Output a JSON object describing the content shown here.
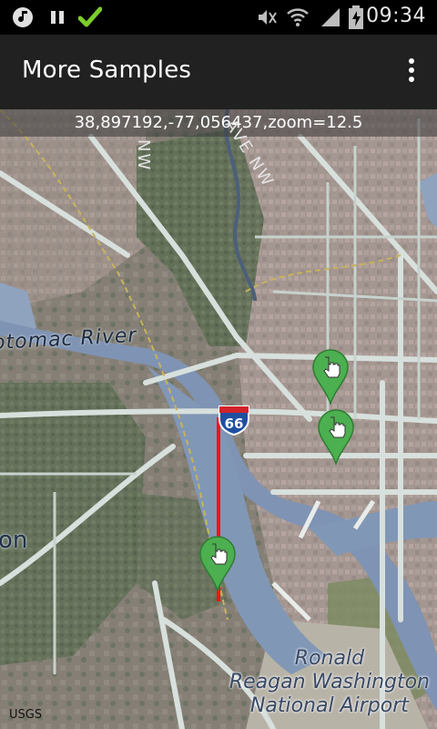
{
  "status_bar": {
    "time": "09:34",
    "icons": [
      "music-note-icon",
      "pause-icon",
      "checkmark-icon",
      "mute-icon",
      "wifi-icon",
      "signal-icon",
      "battery-icon"
    ]
  },
  "action_bar": {
    "title": "More Samples",
    "overflow_icon": "overflow-menu-icon"
  },
  "map": {
    "coordinates_text": "38,897192,-77,056437,zoom=12.5",
    "attribution": "USGS",
    "labels": {
      "river": "otomac River",
      "partial_place": "on",
      "airport_line1": "Ronald",
      "airport_line2": "Reagan Washington",
      "airport_line3": "National Airport",
      "street_ave": "AVE NW",
      "street_nw": "NW"
    },
    "highway_shield": "66",
    "markers": [
      {
        "name": "marker-1",
        "icon": "hand-pointer-icon",
        "color": "#4caf50"
      },
      {
        "name": "marker-2",
        "icon": "hand-pointer-icon",
        "color": "#4caf50"
      },
      {
        "name": "marker-3",
        "icon": "hand-pointer-icon",
        "color": "#4caf50"
      }
    ],
    "route_color": "#ff1111"
  }
}
